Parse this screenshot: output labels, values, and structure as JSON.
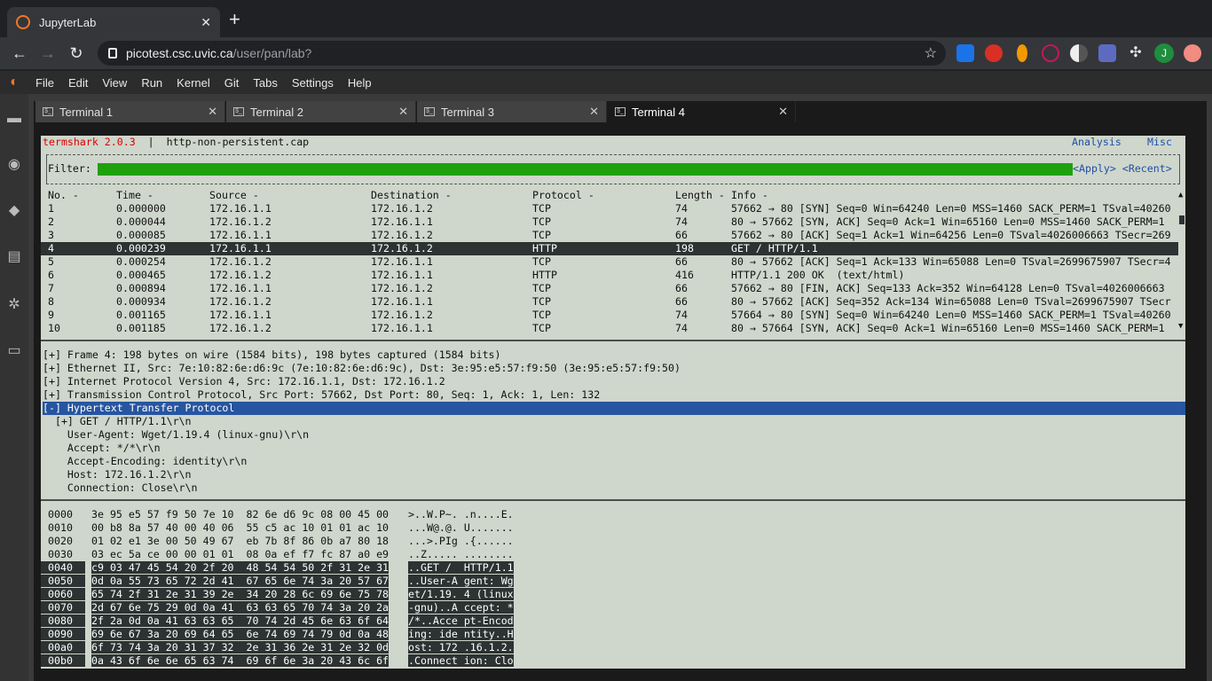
{
  "browser": {
    "tab_title": "JupyterLab",
    "url_host": "picotest.csc.uvic.ca",
    "url_path": "/user/pan/lab?",
    "avatar_letter": "J"
  },
  "jupyter": {
    "menu": [
      "File",
      "Edit",
      "View",
      "Run",
      "Kernel",
      "Git",
      "Tabs",
      "Settings",
      "Help"
    ],
    "tabs": [
      "Terminal 1",
      "Terminal 2",
      "Terminal 3",
      "Terminal 4"
    ],
    "active_tab": 3
  },
  "termshark": {
    "app": "termshark 2.0.3",
    "sep": "|",
    "file": "http-non-persistent.cap",
    "links": [
      "Analysis",
      "Misc"
    ],
    "filter_label": "Filter:",
    "apply": "<Apply>",
    "recent": "<Recent>",
    "columns": [
      "No. -",
      "Time -",
      "Source -",
      "Destination -",
      "Protocol -",
      "Length -",
      "Info -"
    ],
    "packets": [
      [
        "1",
        "0.000000",
        "172.16.1.1",
        "172.16.1.2",
        "TCP",
        "74",
        "57662 → 80 [SYN] Seq=0 Win=64240 Len=0 MSS=1460 SACK_PERM=1 TSval=40260"
      ],
      [
        "2",
        "0.000044",
        "172.16.1.2",
        "172.16.1.1",
        "TCP",
        "74",
        "80 → 57662 [SYN, ACK] Seq=0 Ack=1 Win=65160 Len=0 MSS=1460 SACK_PERM=1"
      ],
      [
        "3",
        "0.000085",
        "172.16.1.1",
        "172.16.1.2",
        "TCP",
        "66",
        "57662 → 80 [ACK] Seq=1 Ack=1 Win=64256 Len=0 TSval=4026006663 TSecr=269"
      ],
      [
        "4",
        "0.000239",
        "172.16.1.1",
        "172.16.1.2",
        "HTTP",
        "198",
        "GET / HTTP/1.1"
      ],
      [
        "5",
        "0.000254",
        "172.16.1.2",
        "172.16.1.1",
        "TCP",
        "66",
        "80 → 57662 [ACK] Seq=1 Ack=133 Win=65088 Len=0 TSval=2699675907 TSecr=4"
      ],
      [
        "6",
        "0.000465",
        "172.16.1.2",
        "172.16.1.1",
        "HTTP",
        "416",
        "HTTP/1.1 200 OK  (text/html)"
      ],
      [
        "7",
        "0.000894",
        "172.16.1.1",
        "172.16.1.2",
        "TCP",
        "66",
        "57662 → 80 [FIN, ACK] Seq=133 Ack=352 Win=64128 Len=0 TSval=4026006663"
      ],
      [
        "8",
        "0.000934",
        "172.16.1.2",
        "172.16.1.1",
        "TCP",
        "66",
        "80 → 57662 [ACK] Seq=352 Ack=134 Win=65088 Len=0 TSval=2699675907 TSecr"
      ],
      [
        "9",
        "0.001165",
        "172.16.1.1",
        "172.16.1.2",
        "TCP",
        "74",
        "57664 → 80 [SYN] Seq=0 Win=64240 Len=0 MSS=1460 SACK_PERM=1 TSval=40260"
      ],
      [
        "10",
        "0.001185",
        "172.16.1.2",
        "172.16.1.1",
        "TCP",
        "74",
        "80 → 57664 [SYN, ACK] Seq=0 Ack=1 Win=65160 Len=0 MSS=1460 SACK_PERM=1"
      ]
    ],
    "selected_packet": 3,
    "details": [
      "[+] Frame 4: 198 bytes on wire (1584 bits), 198 bytes captured (1584 bits)",
      "[+] Ethernet II, Src: 7e:10:82:6e:d6:9c (7e:10:82:6e:d6:9c), Dst: 3e:95:e5:57:f9:50 (3e:95:e5:57:f9:50)",
      "[+] Internet Protocol Version 4, Src: 172.16.1.1, Dst: 172.16.1.2",
      "[+] Transmission Control Protocol, Src Port: 57662, Dst Port: 80, Seq: 1, Ack: 1, Len: 132",
      "[-] Hypertext Transfer Protocol",
      "  [+] GET / HTTP/1.1\\r\\n",
      "    User-Agent: Wget/1.19.4 (linux-gnu)\\r\\n",
      "    Accept: */*\\r\\n",
      "    Accept-Encoding: identity\\r\\n",
      "    Host: 172.16.1.2\\r\\n",
      "    Connection: Close\\r\\n"
    ],
    "selected_detail": 4,
    "hex": [
      [
        "0000",
        "3e 95 e5 57 f9 50 7e 10  82 6e d6 9c 08 00 45 00",
        ">..W.P~. .n....E."
      ],
      [
        "0010",
        "00 b8 8a 57 40 00 40 06  55 c5 ac 10 01 01 ac 10",
        "...W@.@. U......."
      ],
      [
        "0020",
        "01 02 e1 3e 00 50 49 67  eb 7b 8f 86 0b a7 80 18",
        "...>.PIg .{......"
      ],
      [
        "0030",
        "03 ec 5a ce 00 00 01 01  08 0a ef f7 fc 87 a0 e9",
        "..Z..... ........"
      ],
      [
        "0040",
        "c9 03 47 45 54 20 2f 20  48 54 54 50 2f 31 2e 31",
        "..GET /  HTTP/1.1"
      ],
      [
        "0050",
        "0d 0a 55 73 65 72 2d 41  67 65 6e 74 3a 20 57 67",
        "..User-A gent: Wg"
      ],
      [
        "0060",
        "65 74 2f 31 2e 31 39 2e  34 20 28 6c 69 6e 75 78",
        "et/1.19. 4 (linux"
      ],
      [
        "0070",
        "2d 67 6e 75 29 0d 0a 41  63 63 65 70 74 3a 20 2a",
        "-gnu)..A ccept: *"
      ],
      [
        "0080",
        "2f 2a 0d 0a 41 63 63 65  70 74 2d 45 6e 63 6f 64",
        "/*..Acce pt-Encod"
      ],
      [
        "0090",
        "69 6e 67 3a 20 69 64 65  6e 74 69 74 79 0d 0a 48",
        "ing: ide ntity..H"
      ],
      [
        "00a0",
        "6f 73 74 3a 20 31 37 32  2e 31 36 2e 31 2e 32 0d",
        "ost: 172 .16.1.2."
      ],
      [
        "00b0",
        "0a 43 6f 6e 6e 65 63 74  69 6f 6e 3a 20 43 6c 6f",
        ".Connect ion: Clo"
      ]
    ],
    "hex_selected_from": 4
  }
}
